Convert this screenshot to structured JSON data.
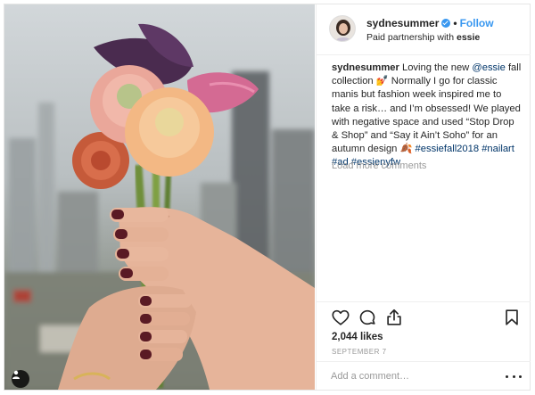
{
  "header": {
    "username": "sydnesummer",
    "verified": true,
    "separator": "•",
    "follow_label": "Follow",
    "subtitle_prefix": "Paid partnership with",
    "subtitle_brand": "essie"
  },
  "caption": {
    "username": "sydnesummer",
    "text_1": "Loving the new",
    "mention": "@essie",
    "text_2": "fall collection 💅 Normally I go for classic manis but fashion week inspired me to take a risk… and I’m obsessed! We played with negative space and used “Stop Drop & Shop” and “Say it Ain’t Soho” for an autumn design 🍂",
    "hashtags": [
      "#essiefall2018",
      "#nailart",
      "#ad",
      "#essienyfw"
    ]
  },
  "load_more_label": "Load more comments",
  "actions": {
    "icons": [
      "heart-icon",
      "comment-icon",
      "share-icon",
      "bookmark-icon"
    ],
    "likes": "2,044 likes",
    "date": "SEPTEMBER 7"
  },
  "comment": {
    "placeholder": "Add a comment…",
    "more_icon": "more-options-icon"
  },
  "colors": {
    "link_blue": "#3897f0",
    "hashtag_blue": "#003569",
    "text": "#262626",
    "muted": "#999999",
    "border": "#efefef"
  }
}
